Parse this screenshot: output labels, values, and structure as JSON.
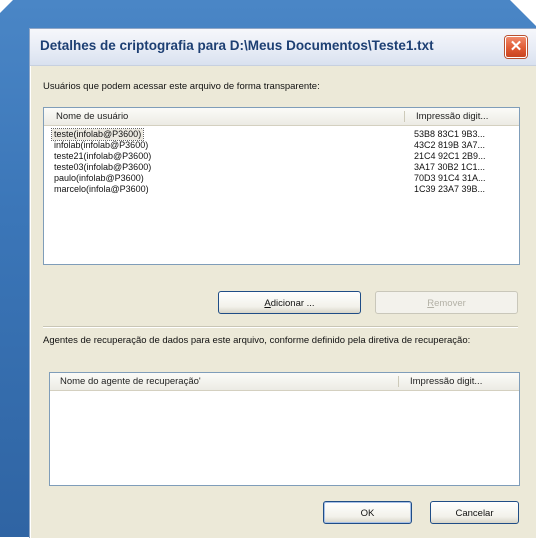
{
  "window": {
    "title": "Detalhes de criptografia para D:\\Meus Documentos\\Teste1.txt",
    "close_symbol": "✕"
  },
  "users_section": {
    "label": "Usuários que podem acessar este arquivo de forma transparente:",
    "columns": [
      "Nome de usuário",
      "Impressão digit..."
    ],
    "rows": [
      {
        "user": "teste(infolab@P3600)",
        "print": "53B8 83C1 9B3..."
      },
      {
        "user": "infolab(infolab@P3600)",
        "print": "43C2 819B 3A7..."
      },
      {
        "user": "teste21(infolab@P3600)",
        "print": "21C4 92C1 2B9..."
      },
      {
        "user": "teste03(infolab@P3600)",
        "print": "3A17 30B2 1C1..."
      },
      {
        "user": "paulo(infolab@P3600)",
        "print": "70D3 91C4 31A..."
      },
      {
        "user": "marcelo(infola@P3600)",
        "print": "1C39 23A7 39B..."
      }
    ],
    "selected_index": 0
  },
  "buttons": {
    "add": {
      "prefix": "",
      "mnemonic": "A",
      "rest": "dicionar ..."
    },
    "remove": {
      "prefix": "",
      "mnemonic": "R",
      "rest": "emover"
    },
    "ok": "OK",
    "cancel": "Cancelar"
  },
  "recovery_section": {
    "label": "Agentes de recuperação de dados para este arquivo, conforme definido pela diretiva de recuperação:",
    "columns": [
      "Nome do agente de recuperação'",
      "Impressão digit..."
    ],
    "rows": []
  },
  "colors": {
    "window_frame": "#3b76b8",
    "title_text": "#1d3f73",
    "dialog_bg": "#ece9d8",
    "close_button": "#e05b35"
  }
}
